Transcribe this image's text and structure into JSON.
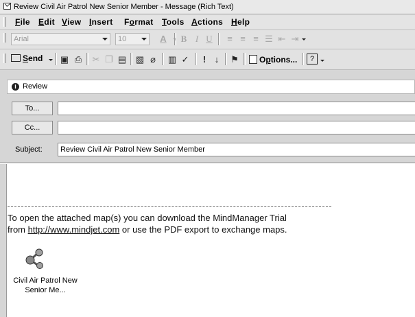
{
  "window": {
    "title": "Review Civil Air Patrol New Senior Member - Message (Rich Text)"
  },
  "menu": [
    "File",
    "Edit",
    "View",
    "Insert",
    "Format",
    "Tools",
    "Actions",
    "Help"
  ],
  "menu_underline": [
    "F",
    "E",
    "V",
    "I",
    "o",
    "T",
    "A",
    "H"
  ],
  "formatting": {
    "font": "Arial",
    "size": "10"
  },
  "toolbar": {
    "send_label": "Send",
    "options_label": "Options..."
  },
  "infobar": {
    "text": "Review"
  },
  "address": {
    "to_label": "To...",
    "cc_label": "Cc...",
    "to_value": "",
    "cc_value": ""
  },
  "subject": {
    "label": "Subject:",
    "value": "Review Civil Air Patrol New Senior Member"
  },
  "body": {
    "line1": "To open the attached map(s) you can download the MindManager Trial",
    "line2_prefix": "from ",
    "link": "http://www.mindjet.com",
    "line2_suffix": " or use the PDF export to exchange maps."
  },
  "attachment": {
    "line1": "Civil Air Patrol New",
    "line2": "Senior Me..."
  },
  "icons": [
    "mail-icon",
    "save-icon",
    "print-icon",
    "cut-icon",
    "copy-icon",
    "paste-icon",
    "attach-file-icon",
    "paperclip-icon",
    "address-book-icon",
    "check-names-icon",
    "importance-high-icon",
    "importance-low-icon",
    "flag-icon",
    "options-icon",
    "help-icon",
    "info-icon",
    "mindmanager-icon"
  ]
}
